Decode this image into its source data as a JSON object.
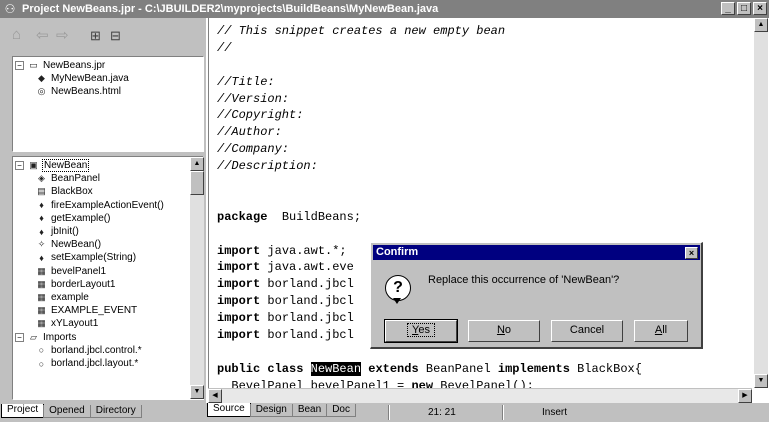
{
  "window": {
    "title": "Project NewBeans.jpr - C:\\JBUILDER2\\myprojects\\BuildBeans\\MyNewBean.java",
    "app_icon": "jbuilder-icon",
    "min": "_",
    "max": "□",
    "close": "×"
  },
  "project_tree": [
    {
      "label": "NewBeans.jpr",
      "icon": "project-icon",
      "expander": "−"
    },
    {
      "label": "MyNewBean.java",
      "icon": "java-file-icon"
    },
    {
      "label": "NewBeans.html",
      "icon": "html-file-icon"
    }
  ],
  "structure_tree": [
    {
      "label": "NewBean",
      "icon": "class-icon",
      "expander": "−",
      "selected": true
    },
    {
      "label": "BeanPanel",
      "icon": "bean-icon"
    },
    {
      "label": "BlackBox",
      "icon": "interface-icon"
    },
    {
      "label": "fireExampleActionEvent()",
      "icon": "method-icon"
    },
    {
      "label": "getExample()",
      "icon": "method-icon"
    },
    {
      "label": "jbInit()",
      "icon": "method-icon"
    },
    {
      "label": "NewBean()",
      "icon": "constructor-icon"
    },
    {
      "label": "setExample(String)",
      "icon": "method-icon"
    },
    {
      "label": "bevelPanel1",
      "icon": "field-icon"
    },
    {
      "label": "borderLayout1",
      "icon": "field-icon"
    },
    {
      "label": "example",
      "icon": "field-icon"
    },
    {
      "label": "EXAMPLE_EVENT",
      "icon": "field-icon"
    },
    {
      "label": "xYLayout1",
      "icon": "field-icon"
    },
    {
      "label": "Imports",
      "icon": "imports-folder-icon",
      "expander": "−"
    },
    {
      "label": "borland.jbcl.control.*",
      "icon": "import-icon"
    },
    {
      "label": "borland.jbcl.layout.*",
      "icon": "import-icon"
    }
  ],
  "left_tabs": [
    "Project",
    "Opened",
    "Directory"
  ],
  "left_active_tab": "Project",
  "editor_tabs": [
    "Source",
    "Design",
    "Bean",
    "Doc"
  ],
  "editor_active_tab": "Source",
  "code_lines": [
    [
      {
        "t": "// This snippet creates a new empty bean",
        "c": "cm"
      }
    ],
    [
      {
        "t": "//",
        "c": "cm"
      }
    ],
    [
      {
        "t": "",
        "c": ""
      }
    ],
    [
      {
        "t": "//Title:",
        "c": "cm"
      }
    ],
    [
      {
        "t": "//Version:",
        "c": "cm"
      }
    ],
    [
      {
        "t": "//Copyright:",
        "c": "cm"
      }
    ],
    [
      {
        "t": "//Author:",
        "c": "cm"
      }
    ],
    [
      {
        "t": "//Company:",
        "c": "cm"
      }
    ],
    [
      {
        "t": "//Description:",
        "c": "cm"
      }
    ],
    [
      {
        "t": "",
        "c": ""
      }
    ],
    [
      {
        "t": "",
        "c": ""
      }
    ],
    [
      {
        "t": "package",
        "c": "kw"
      },
      {
        "t": "  BuildBeans;",
        "c": ""
      }
    ],
    [
      {
        "t": "",
        "c": ""
      }
    ],
    [
      {
        "t": "import",
        "c": "kw"
      },
      {
        "t": " java.awt.*;",
        "c": ""
      }
    ],
    [
      {
        "t": "import",
        "c": "kw"
      },
      {
        "t": " java.awt.eve",
        "c": ""
      }
    ],
    [
      {
        "t": "import",
        "c": "kw"
      },
      {
        "t": " borland.jbcl",
        "c": ""
      }
    ],
    [
      {
        "t": "import",
        "c": "kw"
      },
      {
        "t": " borland.jbcl",
        "c": ""
      }
    ],
    [
      {
        "t": "import",
        "c": "kw"
      },
      {
        "t": " borland.jbcl",
        "c": ""
      }
    ],
    [
      {
        "t": "import",
        "c": "kw"
      },
      {
        "t": " borland.jbcl",
        "c": ""
      }
    ],
    [
      {
        "t": "",
        "c": ""
      }
    ],
    [
      {
        "t": "public class",
        "c": "kw"
      },
      {
        "t": " ",
        "c": ""
      },
      {
        "t": "NewBean",
        "c": "hl"
      },
      {
        "t": " ",
        "c": ""
      },
      {
        "t": "extends",
        "c": "kw"
      },
      {
        "t": " BeanPanel ",
        "c": ""
      },
      {
        "t": "implements",
        "c": "kw"
      },
      {
        "t": " BlackBox{",
        "c": ""
      }
    ],
    [
      {
        "t": "  BevelPanel bevelPanel1 = ",
        "c": ""
      },
      {
        "t": "new",
        "c": "kw"
      },
      {
        "t": " BevelPanel();",
        "c": ""
      }
    ]
  ],
  "status": {
    "position": "21: 21",
    "mode": "Insert"
  },
  "dialog": {
    "title": "Confirm",
    "message": "Replace this occurrence of 'NewBean'?",
    "icon": "question-icon",
    "close": "×",
    "buttons": [
      {
        "label": "Yes",
        "default": true
      },
      {
        "label": "No"
      },
      {
        "label": "Cancel"
      },
      {
        "label": "All"
      }
    ]
  }
}
